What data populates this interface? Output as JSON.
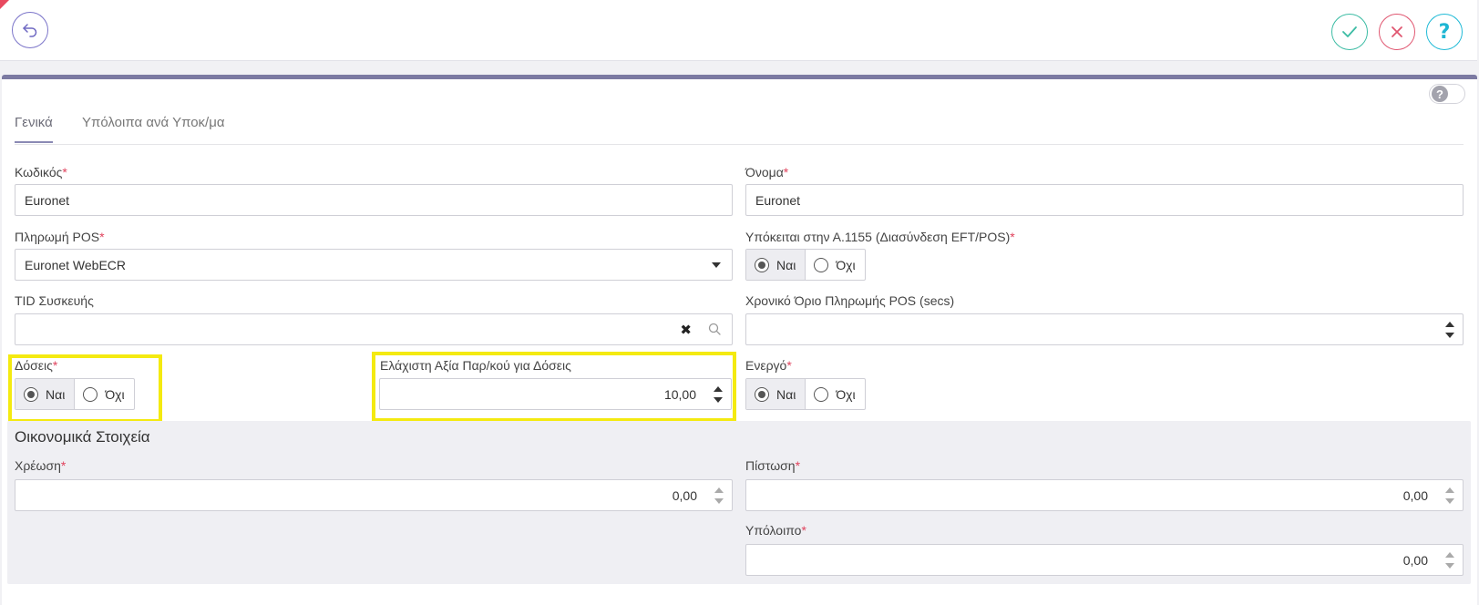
{
  "tabs": [
    "Γενικά",
    "Υπόλοιπα ανά Υποκ/μα"
  ],
  "fields": {
    "code": {
      "label": "Κωδικός",
      "value": "Euronet"
    },
    "name": {
      "label": "Όνομα",
      "value": "Euronet"
    },
    "pos_payment": {
      "label": "Πληρωμή POS",
      "value": "Euronet WebECR"
    },
    "eft_pos": {
      "label": "Υπόκειται στην Α.1155 (Διασύνδεση EFT/POS)",
      "yes": "Ναι",
      "no": "Όχι",
      "selected": "Ναι"
    },
    "tid": {
      "label": "TID Συσκευής",
      "value": ""
    },
    "timeout": {
      "label": "Χρονικό Όριο Πληρωμής POS (secs)",
      "value": ""
    },
    "installments": {
      "label": "Δόσεις",
      "yes": "Ναι",
      "no": "Όχι",
      "selected": "Ναι"
    },
    "min_value": {
      "label": "Ελάχιστη Αξία Παρ/κού για Δόσεις",
      "value": "10,00"
    },
    "active": {
      "label": "Ενεργό",
      "yes": "Ναι",
      "no": "Όχι",
      "selected": "Ναι"
    }
  },
  "financial": {
    "title": "Οικονομικά Στοιχεία",
    "debit": {
      "label": "Χρέωση",
      "value": "0,00"
    },
    "credit": {
      "label": "Πίστωση",
      "value": "0,00"
    },
    "balance": {
      "label": "Υπόλοιπο",
      "value": "0,00"
    }
  },
  "required_marker": "*",
  "icons": {
    "back": "undo-arrow-icon",
    "ok": "check-icon",
    "cancel": "close-icon",
    "help": "question-icon",
    "help_toggle": "question-toggle-icon",
    "help_toggle_glyph": "?",
    "clear": "clear-x-icon",
    "clear_glyph": "✖",
    "search": "search-icon",
    "dropdown": "caret-down-icon"
  },
  "colors": {
    "accent": "#7c7aa2",
    "ok": "#3cbca4",
    "cancel": "#e05670",
    "help": "#1eb6d3",
    "required": "#e0435d",
    "highlight": "#f4ea10"
  }
}
